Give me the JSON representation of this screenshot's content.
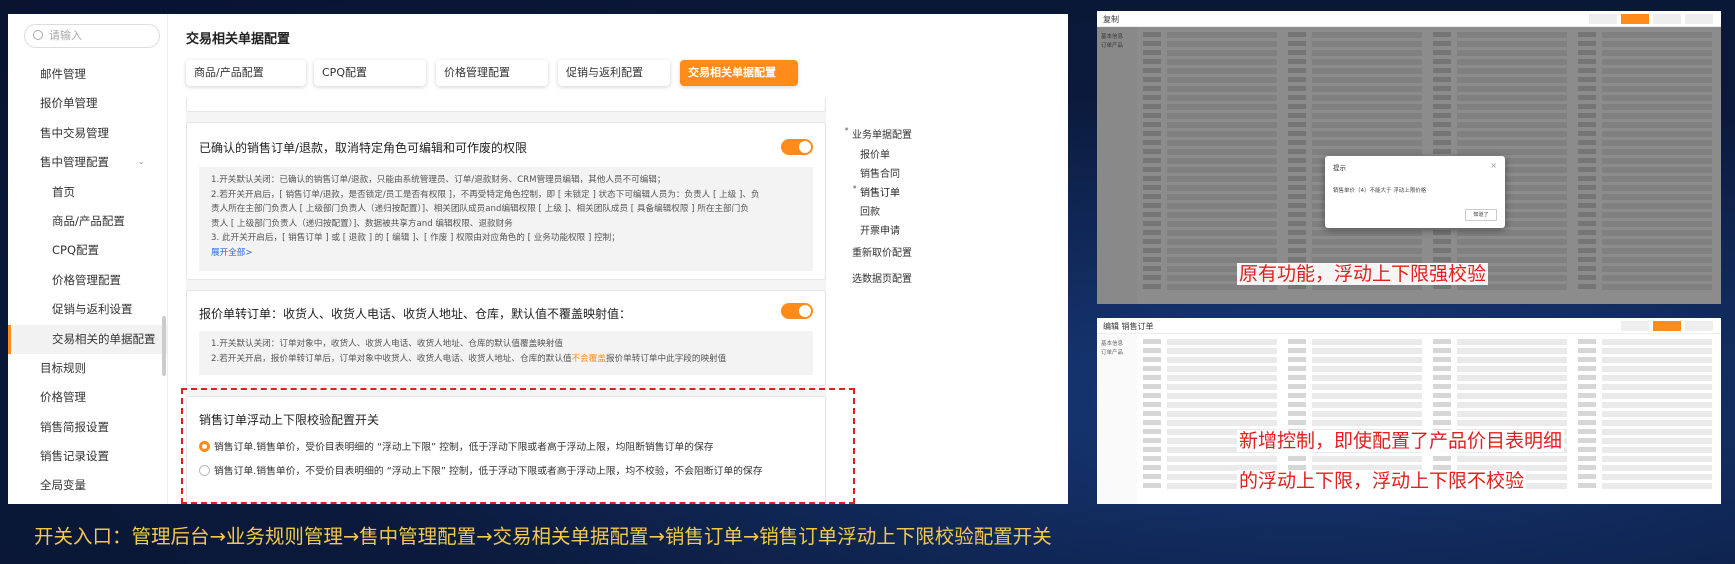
{
  "admin": {
    "search_placeholder": "请输入",
    "menu": [
      {
        "label": "邮件管理",
        "level": 0
      },
      {
        "label": "报价单管理",
        "level": 0
      },
      {
        "label": "售中交易管理",
        "level": 0
      },
      {
        "label": "售中管理配置",
        "level": 0,
        "expanded": true
      },
      {
        "label": "首页",
        "level": 1
      },
      {
        "label": "商品/产品配置",
        "level": 1
      },
      {
        "label": "CPQ配置",
        "level": 1
      },
      {
        "label": "价格管理配置",
        "level": 1
      },
      {
        "label": "促销与返利设置",
        "level": 1
      },
      {
        "label": "交易相关的单据配置",
        "level": 1,
        "active": true
      },
      {
        "label": "目标规则",
        "level": 0
      },
      {
        "label": "价格管理",
        "level": 0
      },
      {
        "label": "销售简报设置",
        "level": 0
      },
      {
        "label": "销售记录设置",
        "level": 0
      },
      {
        "label": "全局变量",
        "level": 0
      }
    ],
    "page_title": "交易相关单据配置",
    "tabs": [
      {
        "label": "商品/产品配置",
        "active": false
      },
      {
        "label": "CPQ配置",
        "active": false
      },
      {
        "label": "价格管理配置",
        "active": false
      },
      {
        "label": "促销与返利配置",
        "active": false
      },
      {
        "label": "交易相关单据配置",
        "active": true
      }
    ],
    "card1": {
      "title": "已确认的销售订单/退款，取消特定角色可编辑和可作废的权限",
      "toggle_on": true,
      "lines": [
        "1.开关默认关闭：已确认的销售订单/退款，只能由系统管理员、订单/退款财务、CRM管理员编辑，其他人员不可编辑；",
        "2.若开关开启后，[ 销售订单/退款，是否锁定/员工是否有权限 ]，不再受特定角色控制，即 [ 未锁定 ] 状态下可编辑人员为：负责人 [ 上级 ]、负",
        "责人所在主部门负责人 [ 上级部门负责人（递归按配置）]、相关团队成员and编辑权限 [ 上级 ]、相关团队成员 [ 具备编辑权限 ] 所在主部门负",
        "责人 [ 上级部门负责人（递归按配置）]、数据被共享方and 编辑权限、退款财务",
        "3. 此开关开启后，[ 销售订单 ] 或 [ 退款 ] 的 [ 编辑 ]、[ 作废 ] 权限由对应角色的 [ 业务功能权限 ] 控制；"
      ],
      "expand_link": "展开全部>"
    },
    "card2": {
      "title": "报价单转订单：收货人、收货人电话、收货人地址、仓库，默认值不覆盖映射值：",
      "toggle_on": true,
      "line1": "1.开关默认关闭：订单对象中，收货人、收货人电话、收货人地址、仓库的默认值覆盖映射值",
      "line2_pre": "2.若开关开启，报价单转订单后，订单对象中收货人、收货人电话、收货人地址、仓库的默认值",
      "line2_hl": "不会覆盖",
      "line2_post": "报价单转订单中此字段的映射值"
    },
    "card3": {
      "title": "销售订单浮动上下限校验配置开关",
      "options": [
        {
          "label": "销售订单.销售单价，受价目表明细的 “浮动上下限” 控制，低于浮动下限或者高于浮动上限，均阻断销售订单的保存",
          "selected": true
        },
        {
          "label": "销售订单.销售单价，不受价目表明细的 “浮动上下限” 控制，低于浮动下限或者高于浮动上限，均不校验，不会阻断订单的保存",
          "selected": false
        }
      ]
    },
    "anchor_nav": [
      {
        "label": "业务单据配置",
        "dot": true
      },
      {
        "label": "报价单"
      },
      {
        "label": "销售合同"
      },
      {
        "label": "销售订单",
        "dot": true,
        "selected": true
      },
      {
        "label": "回款"
      },
      {
        "label": "开票申请"
      },
      {
        "label": "重新取价配置"
      },
      {
        "label": "选数据页配置"
      }
    ]
  },
  "shot1": {
    "header": "复制",
    "nav": [
      "基本信息",
      "订单产品"
    ],
    "dialog_title": "提示",
    "dialog_message": "销售单价（4）不能大于 浮动上限价格",
    "dialog_button": "知道了",
    "annotation": "原有功能，浮动上下限强校验"
  },
  "shot2": {
    "header": "编辑 销售订单",
    "nav": [
      "基本信息",
      "订单产品"
    ],
    "annotation_line1": "新增控制，即使配置了产品价目表明细",
    "annotation_line2": "的浮动上下限，浮动上下限不校验"
  },
  "caption": "开关入口：管理后台→业务规则管理→售中管理配置→交易相关单据配置→销售订单→销售订单浮动上下限校验配置开关",
  "colors": {
    "accent": "#ff8c1a",
    "annotation": "#e02020",
    "caption": "#f2c94c",
    "background": "#0b1a3c"
  }
}
